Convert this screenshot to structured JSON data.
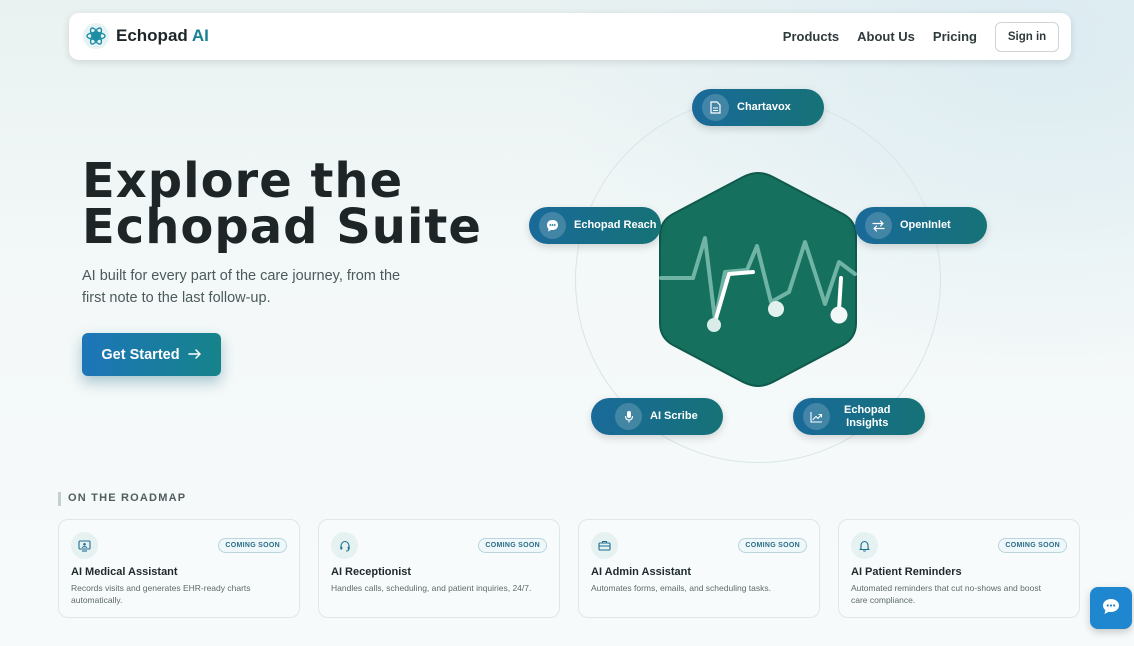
{
  "header": {
    "brand_name": "Echopad",
    "brand_suffix": "AI",
    "nav": {
      "products": "Products",
      "about": "About Us",
      "pricing": "Pricing",
      "signin": "Sign in"
    }
  },
  "hero": {
    "title_line1": "Explore the",
    "title_line2": "Echopad Suite",
    "subtitle": "AI built for every part of the care journey, from the first note to the last follow-up.",
    "cta_label": "Get Started"
  },
  "diagram": {
    "products": {
      "chartavox": "Chartavox",
      "reach": "Echopad Reach",
      "openinlet": "OpenInlet",
      "scribe": "AI Scribe",
      "insights_line1": "Echopad",
      "insights_line2": "Insights"
    }
  },
  "roadmap": {
    "label": "ON THE ROADMAP",
    "cards": [
      {
        "badge": "COMING SOON",
        "title": "AI Medical Assistant",
        "desc": "Records visits and generates EHR-ready charts automatically."
      },
      {
        "badge": "COMING SOON",
        "title": "AI Receptionist",
        "desc": "Handles calls, scheduling, and patient inquiries, 24/7."
      },
      {
        "badge": "COMING SOON",
        "title": "AI Admin Assistant",
        "desc": "Automates forms, emails, and scheduling tasks."
      },
      {
        "badge": "COMING SOON",
        "title": "AI Patient Reminders",
        "desc": "Automated reminders that cut no-shows and boost care compliance."
      }
    ]
  },
  "colors": {
    "accent": "#1a7f93",
    "pill_start": "#1a6a9a",
    "pill_end": "#157276",
    "hexagon": "#15705e",
    "chat_button": "#1f86d0"
  },
  "icons": {
    "logo": "atom-logo-icon",
    "cta": "arrow-right-icon",
    "chartavox": "document-icon",
    "reach": "chat-bubble-icon",
    "openinlet": "swap-arrows-icon",
    "scribe": "microphone-icon",
    "insights": "trend-up-icon",
    "chat": "chat-icon"
  }
}
